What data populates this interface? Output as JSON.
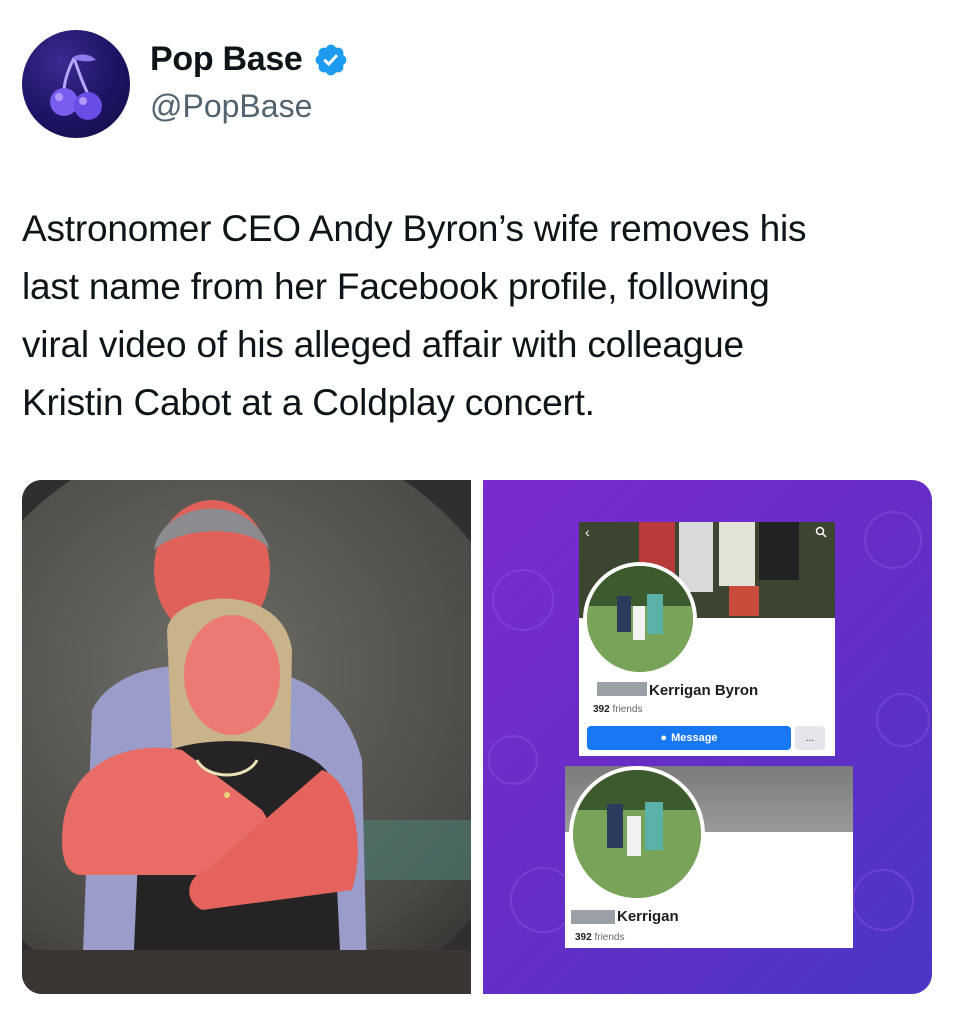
{
  "author": {
    "name": "Pop Base",
    "handle": "@PopBase",
    "verified": true,
    "avatar_icon": "cherry-icon",
    "colors": {
      "verified_badge": "#1d9bf0",
      "avatar_bg": "#1b1464"
    }
  },
  "tweet": {
    "lines": [
      "Astronomer CEO Andy Byron’s wife removes his",
      "last name from her Facebook profile, following",
      "viral video of his alleged affair with colleague",
      "Kristin Cabot at a Coldplay concert."
    ]
  },
  "media": {
    "left_image": "concert-kiss-cam-photo",
    "right_image": {
      "profile_before": {
        "name": "Kerrigan Byron",
        "friends_count": "392",
        "friends_label": "friends",
        "message_button": "Message",
        "more_button": "..."
      },
      "profile_after": {
        "name": "Kerrigan",
        "friends_count": "392",
        "friends_label": "friends"
      },
      "colors": {
        "panel_bg": "#6a2cc7",
        "message_button": "#1877f2"
      }
    }
  }
}
